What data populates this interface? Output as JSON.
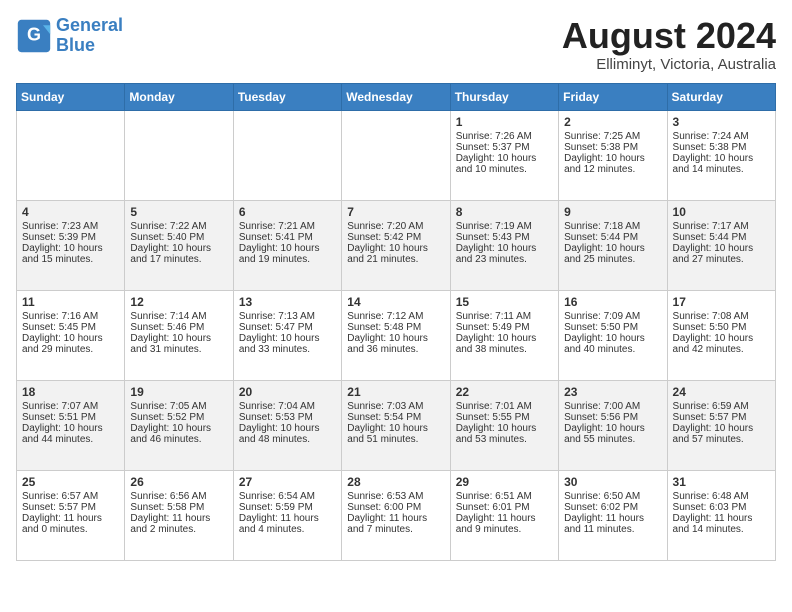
{
  "header": {
    "logo_line1": "General",
    "logo_line2": "Blue",
    "month": "August 2024",
    "location": "Elliminyt, Victoria, Australia"
  },
  "days_of_week": [
    "Sunday",
    "Monday",
    "Tuesday",
    "Wednesday",
    "Thursday",
    "Friday",
    "Saturday"
  ],
  "weeks": [
    [
      {
        "day": "",
        "info": ""
      },
      {
        "day": "",
        "info": ""
      },
      {
        "day": "",
        "info": ""
      },
      {
        "day": "",
        "info": ""
      },
      {
        "day": "1",
        "info": "Sunrise: 7:26 AM\nSunset: 5:37 PM\nDaylight: 10 hours\nand 10 minutes."
      },
      {
        "day": "2",
        "info": "Sunrise: 7:25 AM\nSunset: 5:38 PM\nDaylight: 10 hours\nand 12 minutes."
      },
      {
        "day": "3",
        "info": "Sunrise: 7:24 AM\nSunset: 5:38 PM\nDaylight: 10 hours\nand 14 minutes."
      }
    ],
    [
      {
        "day": "4",
        "info": "Sunrise: 7:23 AM\nSunset: 5:39 PM\nDaylight: 10 hours\nand 15 minutes."
      },
      {
        "day": "5",
        "info": "Sunrise: 7:22 AM\nSunset: 5:40 PM\nDaylight: 10 hours\nand 17 minutes."
      },
      {
        "day": "6",
        "info": "Sunrise: 7:21 AM\nSunset: 5:41 PM\nDaylight: 10 hours\nand 19 minutes."
      },
      {
        "day": "7",
        "info": "Sunrise: 7:20 AM\nSunset: 5:42 PM\nDaylight: 10 hours\nand 21 minutes."
      },
      {
        "day": "8",
        "info": "Sunrise: 7:19 AM\nSunset: 5:43 PM\nDaylight: 10 hours\nand 23 minutes."
      },
      {
        "day": "9",
        "info": "Sunrise: 7:18 AM\nSunset: 5:44 PM\nDaylight: 10 hours\nand 25 minutes."
      },
      {
        "day": "10",
        "info": "Sunrise: 7:17 AM\nSunset: 5:44 PM\nDaylight: 10 hours\nand 27 minutes."
      }
    ],
    [
      {
        "day": "11",
        "info": "Sunrise: 7:16 AM\nSunset: 5:45 PM\nDaylight: 10 hours\nand 29 minutes."
      },
      {
        "day": "12",
        "info": "Sunrise: 7:14 AM\nSunset: 5:46 PM\nDaylight: 10 hours\nand 31 minutes."
      },
      {
        "day": "13",
        "info": "Sunrise: 7:13 AM\nSunset: 5:47 PM\nDaylight: 10 hours\nand 33 minutes."
      },
      {
        "day": "14",
        "info": "Sunrise: 7:12 AM\nSunset: 5:48 PM\nDaylight: 10 hours\nand 36 minutes."
      },
      {
        "day": "15",
        "info": "Sunrise: 7:11 AM\nSunset: 5:49 PM\nDaylight: 10 hours\nand 38 minutes."
      },
      {
        "day": "16",
        "info": "Sunrise: 7:09 AM\nSunset: 5:50 PM\nDaylight: 10 hours\nand 40 minutes."
      },
      {
        "day": "17",
        "info": "Sunrise: 7:08 AM\nSunset: 5:50 PM\nDaylight: 10 hours\nand 42 minutes."
      }
    ],
    [
      {
        "day": "18",
        "info": "Sunrise: 7:07 AM\nSunset: 5:51 PM\nDaylight: 10 hours\nand 44 minutes."
      },
      {
        "day": "19",
        "info": "Sunrise: 7:05 AM\nSunset: 5:52 PM\nDaylight: 10 hours\nand 46 minutes."
      },
      {
        "day": "20",
        "info": "Sunrise: 7:04 AM\nSunset: 5:53 PM\nDaylight: 10 hours\nand 48 minutes."
      },
      {
        "day": "21",
        "info": "Sunrise: 7:03 AM\nSunset: 5:54 PM\nDaylight: 10 hours\nand 51 minutes."
      },
      {
        "day": "22",
        "info": "Sunrise: 7:01 AM\nSunset: 5:55 PM\nDaylight: 10 hours\nand 53 minutes."
      },
      {
        "day": "23",
        "info": "Sunrise: 7:00 AM\nSunset: 5:56 PM\nDaylight: 10 hours\nand 55 minutes."
      },
      {
        "day": "24",
        "info": "Sunrise: 6:59 AM\nSunset: 5:57 PM\nDaylight: 10 hours\nand 57 minutes."
      }
    ],
    [
      {
        "day": "25",
        "info": "Sunrise: 6:57 AM\nSunset: 5:57 PM\nDaylight: 11 hours\nand 0 minutes."
      },
      {
        "day": "26",
        "info": "Sunrise: 6:56 AM\nSunset: 5:58 PM\nDaylight: 11 hours\nand 2 minutes."
      },
      {
        "day": "27",
        "info": "Sunrise: 6:54 AM\nSunset: 5:59 PM\nDaylight: 11 hours\nand 4 minutes."
      },
      {
        "day": "28",
        "info": "Sunrise: 6:53 AM\nSunset: 6:00 PM\nDaylight: 11 hours\nand 7 minutes."
      },
      {
        "day": "29",
        "info": "Sunrise: 6:51 AM\nSunset: 6:01 PM\nDaylight: 11 hours\nand 9 minutes."
      },
      {
        "day": "30",
        "info": "Sunrise: 6:50 AM\nSunset: 6:02 PM\nDaylight: 11 hours\nand 11 minutes."
      },
      {
        "day": "31",
        "info": "Sunrise: 6:48 AM\nSunset: 6:03 PM\nDaylight: 11 hours\nand 14 minutes."
      }
    ]
  ]
}
